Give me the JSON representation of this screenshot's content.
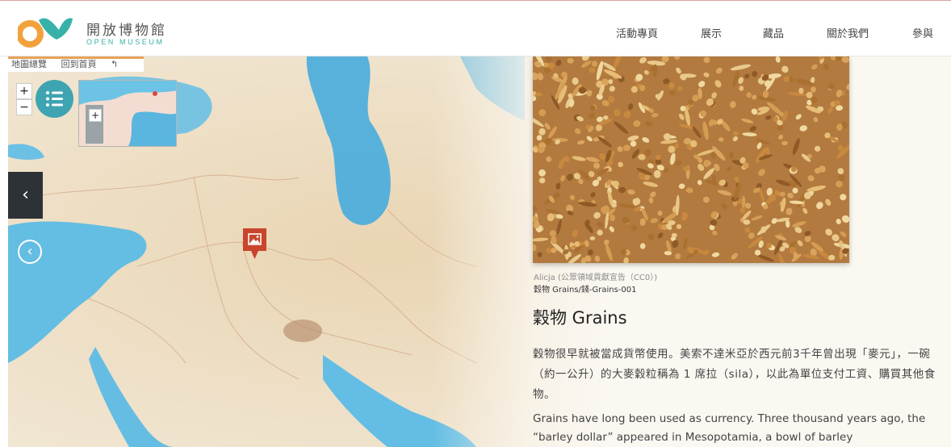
{
  "brand": {
    "name_cn": "開放博物館",
    "name_en": "OPEN MUSEUM",
    "colors": {
      "orange": "#f2a23c",
      "teal": "#37b2a8"
    }
  },
  "nav": {
    "items": [
      "活動專頁",
      "展示",
      "藏品",
      "關於我們",
      "參與"
    ]
  },
  "map": {
    "tabs": [
      "地圖總覽",
      "回到首頁"
    ],
    "zoom_in": "+",
    "zoom_out": "−",
    "minimap_zoom": "+",
    "panel_toggle": "‹",
    "prev": "‹",
    "marker_icon": "image-icon",
    "colors": {
      "land": "#efe3cd",
      "water": "#5fb8df",
      "marker": "#c8452c",
      "list_button": "#3fa4b1"
    }
  },
  "item": {
    "credit": "Alicja (公眾領域貢獻宣告（CC0）)",
    "id": "穀物 Grains/錢-Grains-001",
    "title": "穀物 Grains",
    "desc_zh": "穀物很早就被當成貨幣使用。美索不達米亞於西元前3千年曾出現「麥元」，一碗（約一公升）的大麥穀粒稱為 1 席拉（sila），以此為單位支付工資、購買其他食物。",
    "desc_en": "Grains have long been used as currency. Three thousand years ago, the “barley dollar” appeared in Mesopotamia, a bowl of barley"
  }
}
